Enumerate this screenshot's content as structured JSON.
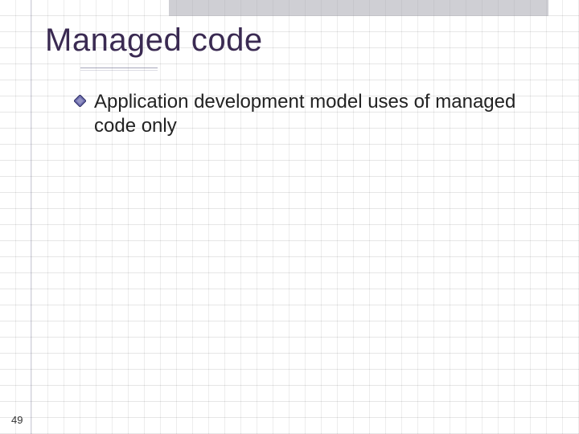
{
  "slide": {
    "title": "Managed code",
    "page_number": "49",
    "bullets": [
      {
        "text": "Application development model uses of managed code only"
      }
    ]
  },
  "colors": {
    "title": "#3a2a52",
    "bullet_fill": "#6f6faf",
    "bullet_stroke": "#2d2d66"
  }
}
